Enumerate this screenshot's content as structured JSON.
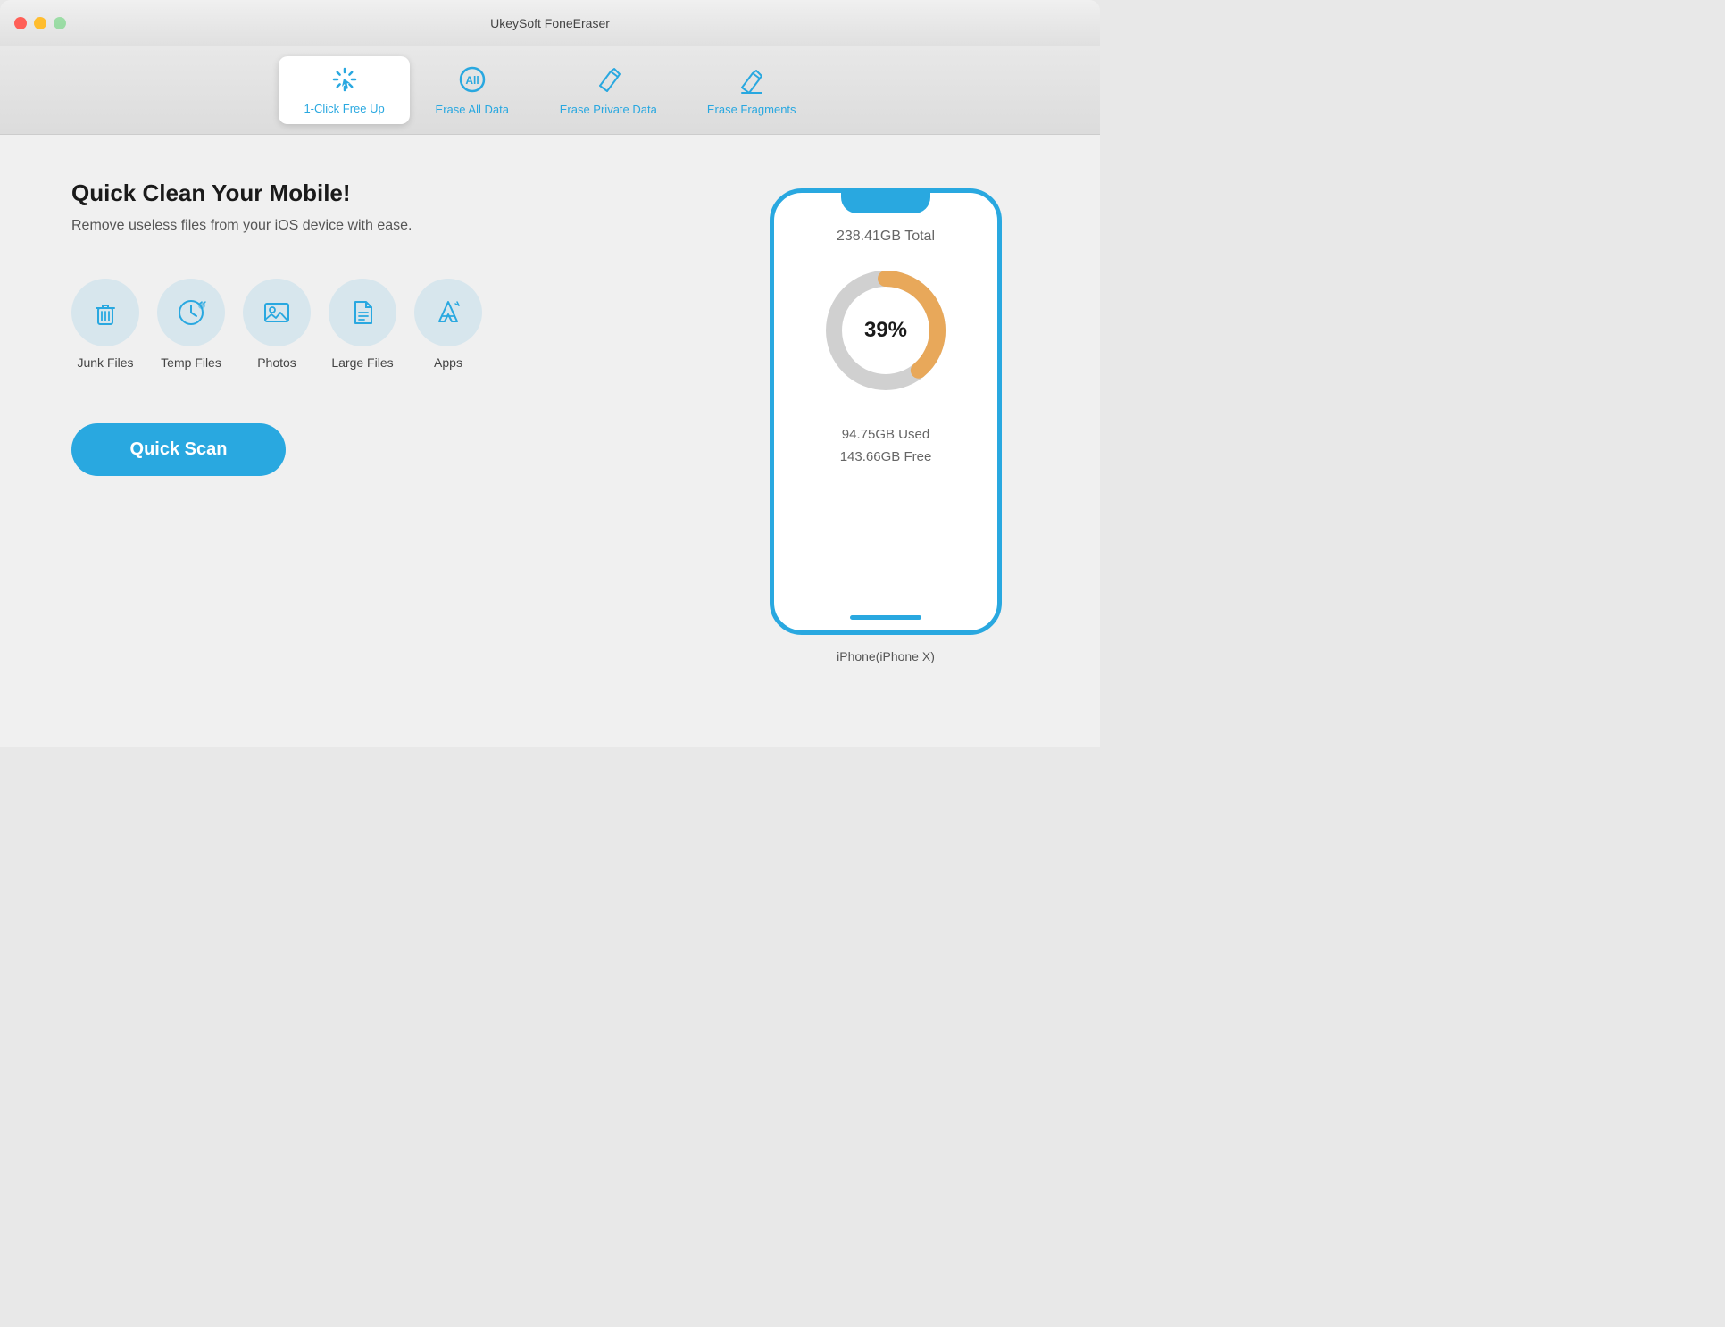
{
  "titleBar": {
    "title": "UkeySoft FoneEraser"
  },
  "tabs": [
    {
      "id": "one-click",
      "label": "1-Click Free Up",
      "active": true,
      "icon": "cursor"
    },
    {
      "id": "erase-all",
      "label": "Erase All Data",
      "active": false,
      "icon": "all"
    },
    {
      "id": "erase-private",
      "label": "Erase Private Data",
      "active": false,
      "icon": "eraser1"
    },
    {
      "id": "erase-fragments",
      "label": "Erase Fragments",
      "active": false,
      "icon": "eraser2"
    }
  ],
  "main": {
    "headline": "Quick Clean Your Mobile!",
    "subheadline": "Remove useless files from your iOS device with ease.",
    "features": [
      {
        "id": "junk-files",
        "label": "Junk Files"
      },
      {
        "id": "temp-files",
        "label": "Temp Files"
      },
      {
        "id": "photos",
        "label": "Photos"
      },
      {
        "id": "large-files",
        "label": "Large Files"
      },
      {
        "id": "apps",
        "label": "Apps"
      }
    ],
    "quickScanButton": "Quick Scan"
  },
  "device": {
    "totalStorage": "238.41GB Total",
    "usedPercent": 39,
    "usedLabel": "39%",
    "usedStorage": "94.75GB Used",
    "freeStorage": "143.66GB Free",
    "deviceName": "iPhone(iPhone X)"
  },
  "colors": {
    "blue": "#29a8e0",
    "orange": "#e8a85a",
    "gray": "#d0d0d0",
    "white": "#ffffff"
  }
}
